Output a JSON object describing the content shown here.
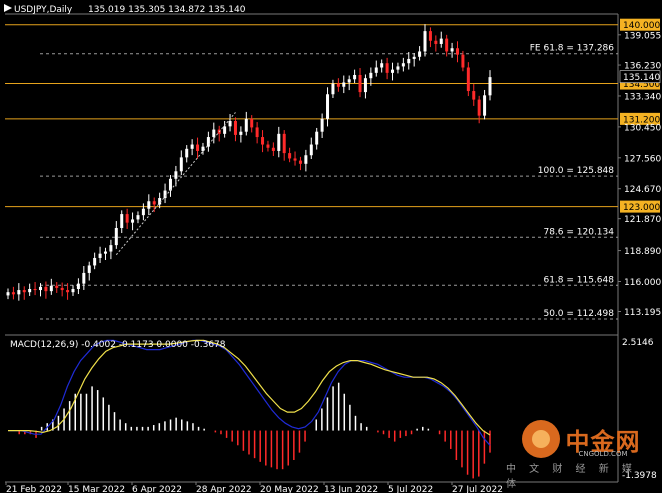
{
  "header": {
    "symbol": "USDJPY,Daily",
    "ohlc": "135.019 135.305 134.872 135.140"
  },
  "macd": {
    "label": "MACD(12,26,9) -0.4002 -0.1173 0.0000 -0.3678",
    "axis_top": "2.5146",
    "axis_bottom": "-1.3978",
    "hist_color_up": "#ffffff",
    "hist_color_down": "#ff2a2a",
    "main_color": "#1f2bd6",
    "signal_color": "#f0e04a",
    "histogram": [
      0.0,
      0.0,
      -0.1,
      -0.1,
      -0.1,
      -0.2,
      0.1,
      0.2,
      0.3,
      0.4,
      0.6,
      0.8,
      1.0,
      1.0,
      1.0,
      1.2,
      1.1,
      0.9,
      0.7,
      0.5,
      0.3,
      0.2,
      0.1,
      0.1,
      0.1,
      0.1,
      0.15,
      0.2,
      0.25,
      0.3,
      0.35,
      0.3,
      0.25,
      0.2,
      0.1,
      0.05,
      0.0,
      -0.05,
      -0.1,
      -0.2,
      -0.3,
      -0.4,
      -0.55,
      -0.65,
      -0.75,
      -0.85,
      -0.95,
      -1.0,
      -1.05,
      -1.05,
      -0.95,
      -0.8,
      -0.6,
      -0.3,
      0.0,
      0.3,
      0.6,
      0.9,
      1.2,
      1.3,
      1.0,
      0.7,
      0.4,
      0.2,
      0.1,
      0.0,
      -0.05,
      -0.1,
      -0.2,
      -0.3,
      -0.2,
      -0.15,
      -0.1,
      0.05,
      0.1,
      0.05,
      0.0,
      -0.1,
      -0.3,
      -0.5,
      -0.8,
      -1.0,
      -1.2,
      -1.3,
      -1.25,
      -0.9,
      -0.6
    ],
    "main": [
      0.0,
      0.0,
      0.0,
      -0.05,
      -0.1,
      -0.1,
      0.1,
      0.3,
      0.7,
      1.2,
      1.6,
      1.9,
      2.1,
      2.3,
      2.4,
      2.45,
      2.45,
      2.4,
      2.35,
      2.3,
      2.25,
      2.2,
      2.2,
      2.2,
      2.25,
      2.3,
      2.35,
      2.4,
      2.45,
      2.45,
      2.4,
      2.35,
      2.3,
      2.2,
      2.0,
      1.8,
      1.55,
      1.3,
      1.05,
      0.8,
      0.55,
      0.35,
      0.2,
      0.1,
      0.05,
      0.1,
      0.25,
      0.5,
      0.9,
      1.3,
      1.6,
      1.8,
      1.9,
      1.9,
      1.9,
      1.85,
      1.8,
      1.7,
      1.6,
      1.5,
      1.45,
      1.45,
      1.45,
      1.45,
      1.4,
      1.3,
      1.2,
      1.05,
      0.85,
      0.6,
      0.35,
      0.1,
      -0.2,
      -0.4
    ],
    "signal": [
      0.0,
      0.0,
      0.0,
      0.0,
      -0.02,
      -0.05,
      0.0,
      0.1,
      0.3,
      0.6,
      1.0,
      1.4,
      1.7,
      1.95,
      2.15,
      2.25,
      2.3,
      2.35,
      2.35,
      2.35,
      2.35,
      2.35,
      2.35,
      2.35,
      2.37,
      2.4,
      2.43,
      2.45,
      2.45,
      2.4,
      2.35,
      2.25,
      2.1,
      1.95,
      1.75,
      1.5,
      1.25,
      1.0,
      0.8,
      0.6,
      0.5,
      0.5,
      0.6,
      0.8,
      1.05,
      1.35,
      1.6,
      1.75,
      1.85,
      1.9,
      1.9,
      1.85,
      1.8,
      1.72,
      1.65,
      1.6,
      1.55,
      1.5,
      1.45,
      1.45,
      1.45,
      1.4,
      1.3,
      1.15,
      0.95,
      0.7,
      0.45,
      0.2,
      0.0,
      -0.12
    ]
  },
  "watermark": {
    "big": "中金网",
    "domain": "CNGOLD.COM",
    "sub": "中 文 财 经 新 媒 体"
  },
  "chart_data": {
    "type": "candlestick",
    "symbol": "USDJPY",
    "timeframe": "Daily",
    "ylim": [
      111.0,
      141.0
    ],
    "y_ticks": [
      "139.055",
      "136.230",
      "133.340",
      "130.450",
      "127.560",
      "124.670",
      "121.870",
      "118.890",
      "116.000",
      "113.195"
    ],
    "x_ticks": [
      "21 Feb 2022",
      "15 Mar 2022",
      "6 Apr 2022",
      "28 Apr 2022",
      "20 May 2022",
      "13 Jun 2022",
      "5 Jul 2022",
      "27 Jul 2022"
    ],
    "levels": [
      {
        "price": 140.0,
        "label": "140.000",
        "kind": "solid"
      },
      {
        "price": 134.5,
        "label": "134.500",
        "kind": "solid"
      },
      {
        "price": 131.2,
        "label": "131.200",
        "kind": "solid"
      },
      {
        "price": 123.0,
        "label": "123.000",
        "kind": "solid"
      },
      {
        "price": 137.286,
        "label": "FE 61.8 = 137.286",
        "kind": "dashed"
      },
      {
        "price": 125.848,
        "label": "100.0 = 125.848",
        "kind": "dashed"
      },
      {
        "price": 120.134,
        "label": "78.6 = 120.134",
        "kind": "dashed"
      },
      {
        "price": 115.648,
        "label": "61.8 = 115.648",
        "kind": "dashed"
      },
      {
        "price": 112.498,
        "label": "50.0 = 112.498",
        "kind": "dashed"
      }
    ],
    "current_price": "135.140",
    "closes": [
      115.0,
      114.8,
      115.2,
      115.0,
      115.3,
      115.2,
      115.5,
      115.1,
      115.6,
      115.4,
      115.2,
      115.0,
      115.3,
      115.8,
      116.8,
      117.5,
      118.2,
      118.6,
      118.8,
      119.4,
      121.0,
      122.3,
      121.5,
      121.8,
      122.2,
      122.8,
      123.5,
      123.2,
      123.8,
      124.5,
      125.6,
      126.3,
      127.6,
      128.4,
      128.8,
      128.2,
      128.6,
      129.5,
      130.2,
      129.8,
      130.5,
      131.0,
      129.7,
      130.0,
      131.2,
      130.4,
      129.5,
      128.8,
      128.5,
      128.2,
      129.8,
      128.0,
      127.5,
      127.3,
      127.0,
      127.8,
      128.8,
      130.0,
      131.2,
      133.5,
      134.5,
      134.2,
      134.6,
      134.9,
      135.3,
      133.7,
      135.0,
      135.5,
      136.0,
      136.4,
      135.5,
      135.8,
      136.1,
      136.4,
      136.8,
      137.0,
      137.5,
      139.4,
      138.5,
      138.2,
      138.7,
      137.5,
      137.8,
      137.2,
      136.0,
      133.8,
      133.0,
      131.5,
      133.4,
      135.1
    ]
  }
}
